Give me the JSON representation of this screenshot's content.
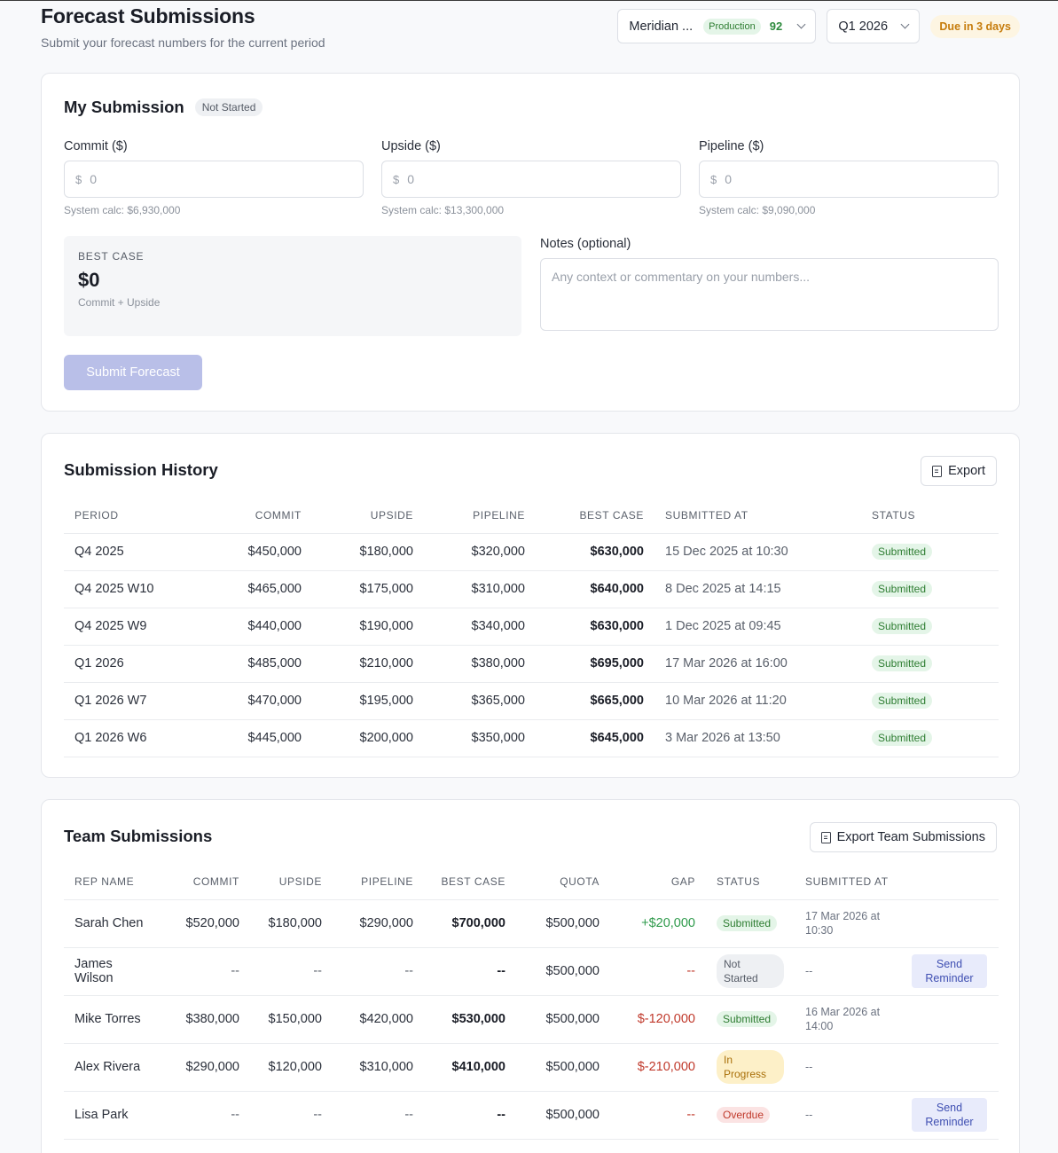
{
  "header": {
    "title": "Forecast Submissions",
    "subtitle": "Submit your forecast numbers for the current period",
    "org_name": "Meridian ...",
    "env_badge": "Production",
    "score": "92",
    "period": "Q1 2026",
    "due": "Due in 3 days"
  },
  "my_submission": {
    "title": "My Submission",
    "status": "Not Started",
    "fields": [
      {
        "label": "Commit ($)",
        "currency": "$",
        "placeholder": "0",
        "hint": "System calc: $6,930,000"
      },
      {
        "label": "Upside ($)",
        "currency": "$",
        "placeholder": "0",
        "hint": "System calc: $13,300,000"
      },
      {
        "label": "Pipeline ($)",
        "currency": "$",
        "placeholder": "0",
        "hint": "System calc: $9,090,000"
      }
    ],
    "best_case_label": "BEST CASE",
    "best_case_value": "$0",
    "best_case_caption": "Commit + Upside",
    "notes_label": "Notes (optional)",
    "notes_placeholder": "Any context or commentary on your numbers...",
    "submit_label": "Submit Forecast"
  },
  "history": {
    "title": "Submission History",
    "export_label": "Export",
    "columns": [
      "PERIOD",
      "COMMIT",
      "UPSIDE",
      "PIPELINE",
      "BEST CASE",
      "SUBMITTED AT",
      "STATUS"
    ],
    "rows": [
      {
        "period": "Q4 2025",
        "commit": "$450,000",
        "upside": "$180,000",
        "pipeline": "$320,000",
        "best": "$630,000",
        "submitted": "15 Dec 2025 at 10:30",
        "status": "Submitted"
      },
      {
        "period": "Q4 2025 W10",
        "commit": "$465,000",
        "upside": "$175,000",
        "pipeline": "$310,000",
        "best": "$640,000",
        "submitted": "8 Dec 2025 at 14:15",
        "status": "Submitted"
      },
      {
        "period": "Q4 2025 W9",
        "commit": "$440,000",
        "upside": "$190,000",
        "pipeline": "$340,000",
        "best": "$630,000",
        "submitted": "1 Dec 2025 at 09:45",
        "status": "Submitted"
      },
      {
        "period": "Q1 2026",
        "commit": "$485,000",
        "upside": "$210,000",
        "pipeline": "$380,000",
        "best": "$695,000",
        "submitted": "17 Mar 2026 at 16:00",
        "status": "Submitted"
      },
      {
        "period": "Q1 2026 W7",
        "commit": "$470,000",
        "upside": "$195,000",
        "pipeline": "$365,000",
        "best": "$665,000",
        "submitted": "10 Mar 2026 at 11:20",
        "status": "Submitted"
      },
      {
        "period": "Q1 2026 W6",
        "commit": "$445,000",
        "upside": "$200,000",
        "pipeline": "$350,000",
        "best": "$645,000",
        "submitted": "3 Mar 2026 at 13:50",
        "status": "Submitted"
      }
    ]
  },
  "team": {
    "title": "Team Submissions",
    "export_label": "Export Team Submissions",
    "columns": [
      "REP NAME",
      "COMMIT",
      "UPSIDE",
      "PIPELINE",
      "BEST CASE",
      "QUOTA",
      "GAP",
      "STATUS",
      "SUBMITTED AT"
    ],
    "rows": [
      {
        "name": "Sarah Chen",
        "commit": "$520,000",
        "upside": "$180,000",
        "pipeline": "$290,000",
        "best": "$700,000",
        "quota": "$500,000",
        "gap": "+$20,000",
        "gap_kind": "pos",
        "status": "Submitted",
        "status_kind": "sub",
        "submitted": "17 Mar 2026 at 10:30",
        "action": ""
      },
      {
        "name": "James Wilson",
        "commit": "--",
        "upside": "--",
        "pipeline": "--",
        "best": "--",
        "quota": "$500,000",
        "gap": "--",
        "gap_kind": "neg",
        "status": "Not Started",
        "status_kind": "ns",
        "submitted": "--",
        "action": "Send Reminder"
      },
      {
        "name": "Mike Torres",
        "commit": "$380,000",
        "upside": "$150,000",
        "pipeline": "$420,000",
        "best": "$530,000",
        "quota": "$500,000",
        "gap": "$-120,000",
        "gap_kind": "neg",
        "status": "Submitted",
        "status_kind": "sub",
        "submitted": "16 Mar 2026 at 14:00",
        "action": ""
      },
      {
        "name": "Alex Rivera",
        "commit": "$290,000",
        "upside": "$120,000",
        "pipeline": "$310,000",
        "best": "$410,000",
        "quota": "$500,000",
        "gap": "$-210,000",
        "gap_kind": "neg",
        "status": "In Progress",
        "status_kind": "ip",
        "submitted": "--",
        "action": ""
      },
      {
        "name": "Lisa Park",
        "commit": "--",
        "upside": "--",
        "pipeline": "--",
        "best": "--",
        "quota": "$500,000",
        "gap": "--",
        "gap_kind": "neg",
        "status": "Overdue",
        "status_kind": "od",
        "submitted": "--",
        "action": "Send Reminder"
      }
    ]
  }
}
